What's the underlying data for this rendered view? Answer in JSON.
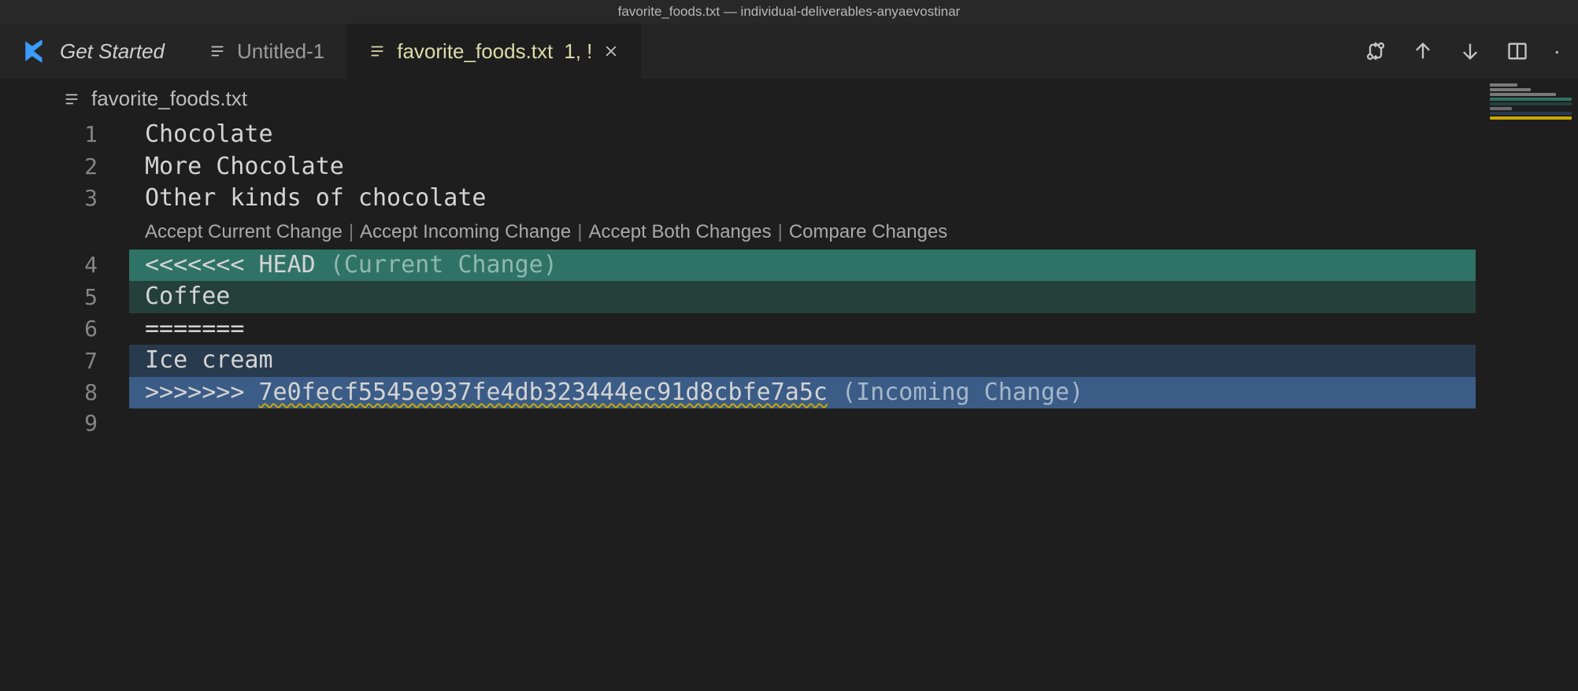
{
  "titlebar": "favorite_foods.txt — individual-deliverables-anyaevostinar",
  "tabs": {
    "get_started": "Get Started",
    "untitled": "Untitled-1",
    "active_file": "favorite_foods.txt",
    "active_badge": "1, !"
  },
  "breadcrumb": {
    "file": "favorite_foods.txt"
  },
  "editor": {
    "lines": {
      "l1": "Chocolate",
      "l2": "More Chocolate",
      "l3": "Other kinds of chocolate",
      "l4_marker": "<<<<<<< HEAD",
      "l4_label": "(Current Change)",
      "l5": "Coffee",
      "l6": "=======",
      "l7": "Ice cream",
      "l8_marker": ">>>>>>> ",
      "l8_hash": "7e0fecf5545e937fe4db323444ec91d8cbfe7a5c",
      "l8_label": "(Incoming Change)",
      "l9": ""
    },
    "numbers": {
      "n1": "1",
      "n2": "2",
      "n3": "3",
      "n4": "4",
      "n5": "5",
      "n6": "6",
      "n7": "7",
      "n8": "8",
      "n9": "9"
    }
  },
  "codelens": {
    "accept_current": "Accept Current Change",
    "accept_incoming": "Accept Incoming Change",
    "accept_both": "Accept Both Changes",
    "compare": "Compare Changes"
  }
}
